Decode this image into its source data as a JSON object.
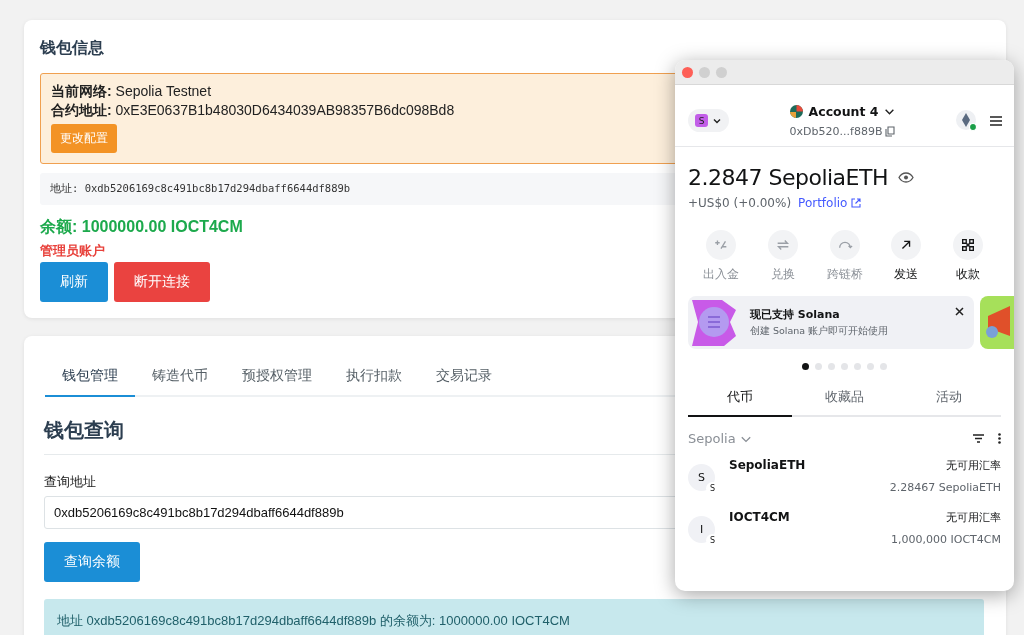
{
  "wallet_info": {
    "title": "钱包信息",
    "network_line": "**当前网络:** Sepolia Testnet",
    "contract_line": "**合约地址:** 0xE3E0637B1b48030D6434039AB98357B6dc098Bd8",
    "change_config_button": "更改配置",
    "address_line": "地址: 0xdb5206169c8c491bc8b17d294dbaff6644df889b",
    "balance": "余额: 1000000.00 IOCT4CM",
    "role": "管理员账户",
    "buttons": [
      {
        "label": "刷新",
        "kind": "primary"
      },
      {
        "label": "断开连接",
        "kind": "danger"
      }
    ]
  },
  "tabs": [
    {
      "label": "钱包管理",
      "selected": true
    },
    {
      "label": "铸造代币",
      "selected": false
    },
    {
      "label": "预授权管理",
      "selected": false
    },
    {
      "label": "执行扣款",
      "selected": false
    },
    {
      "label": "交易记录",
      "selected": false
    }
  ],
  "wallet_query": {
    "title": "钱包查询",
    "field_label": "查询地址",
    "field_value": "0xdb5206169c8c491bc8b17d294dbaff6644df889b",
    "button": "查询余额",
    "result": "地址 0xdb5206169c8c491bc8b17d294dbaff6644df889b 的余额为: 1000000.00 IOCT4CM"
  },
  "wallet_popup": {
    "network_badge": "S",
    "account": "Account 4",
    "address": "0xDb520...f889B",
    "balance": "2.2847 SepoliaETH",
    "fiat_change": "+US$0 (+0.00%)",
    "portfolio_link": "Portfolio",
    "actions": [
      {
        "label": "出入金",
        "kind": "buy-sell",
        "disabled": true
      },
      {
        "label": "兑换",
        "kind": "swap",
        "disabled": true
      },
      {
        "label": "跨链桥",
        "kind": "bridge",
        "disabled": true
      },
      {
        "label": "发送",
        "kind": "send",
        "disabled": false
      },
      {
        "label": "收款",
        "kind": "receive",
        "disabled": false
      }
    ],
    "banner": {
      "title": "现已支持 Solana",
      "subtitle": "创建 Solana 账户即可开始使用"
    },
    "carousel_dots": [
      {
        "selected": true
      },
      {
        "selected": false
      },
      {
        "selected": false
      },
      {
        "selected": false
      },
      {
        "selected": false
      },
      {
        "selected": false
      },
      {
        "selected": false
      }
    ],
    "tabs": [
      {
        "label": "代币",
        "selected": true
      },
      {
        "label": "收藏品",
        "selected": false
      },
      {
        "label": "活动",
        "selected": false
      }
    ],
    "network_filter": "Sepolia",
    "tokens": [
      {
        "avatar": "S",
        "badge": "S",
        "name": "SepoliaETH",
        "rate": "无可用汇率",
        "amount": "2.28467 SepoliaETH"
      },
      {
        "avatar": "I",
        "badge": "S",
        "name": "IOCT4CM",
        "rate": "无可用汇率",
        "amount": "1,000,000 IOCT4CM"
      }
    ]
  }
}
